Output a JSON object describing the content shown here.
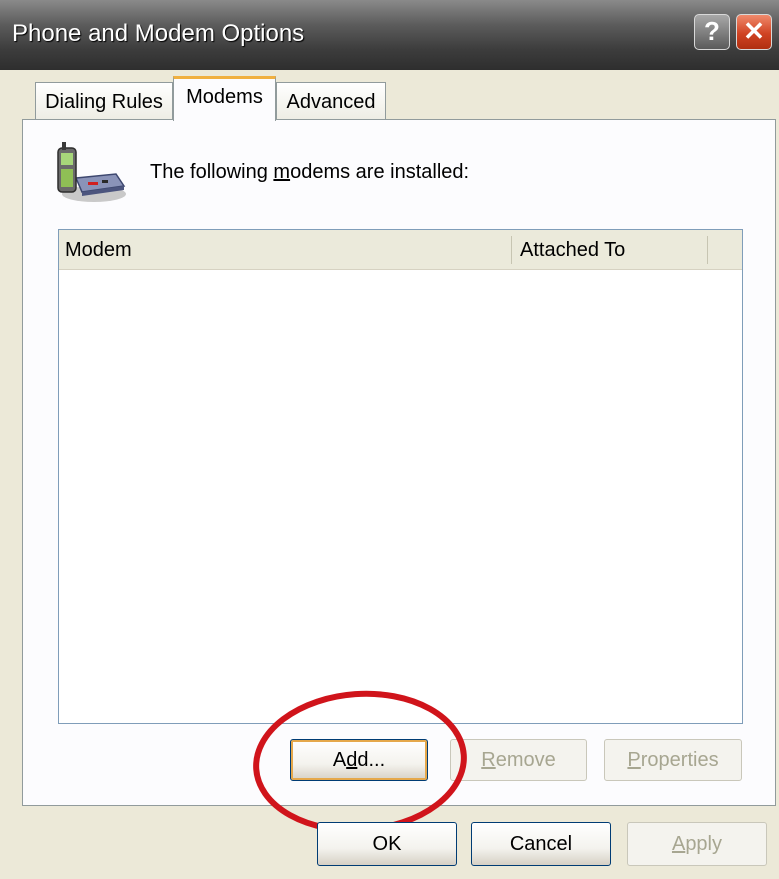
{
  "window": {
    "title": "Phone and Modem Options"
  },
  "titlebar_buttons": {
    "help_label": "?",
    "close_label": "✕",
    "help_icon": "help-icon",
    "close_icon": "close-icon"
  },
  "tabs": [
    {
      "label": "Dialing Rules",
      "selected": false
    },
    {
      "label": "Modems",
      "selected": true
    },
    {
      "label": "Advanced",
      "selected": false
    }
  ],
  "modems_panel": {
    "icon": "phone-modem-icon",
    "install_text_before": "The following ",
    "install_text_underlined": "m",
    "install_text_after": "odems are  installed:",
    "list": {
      "columns": [
        "Modem",
        "Attached To"
      ],
      "rows": []
    },
    "buttons": {
      "add_before": "A",
      "add_underlined": "d",
      "add_after": "d...",
      "remove_underlined": "R",
      "remove_after": "emove",
      "properties_underlined": "P",
      "properties_after": "roperties"
    }
  },
  "dialog_buttons": {
    "ok": "OK",
    "cancel": "Cancel",
    "apply_underlined": "A",
    "apply_after": "pply"
  },
  "colors": {
    "annotation_circle": "#d0141b",
    "close_button": "#d04323",
    "selected_tab_accent": "#f0b040"
  }
}
